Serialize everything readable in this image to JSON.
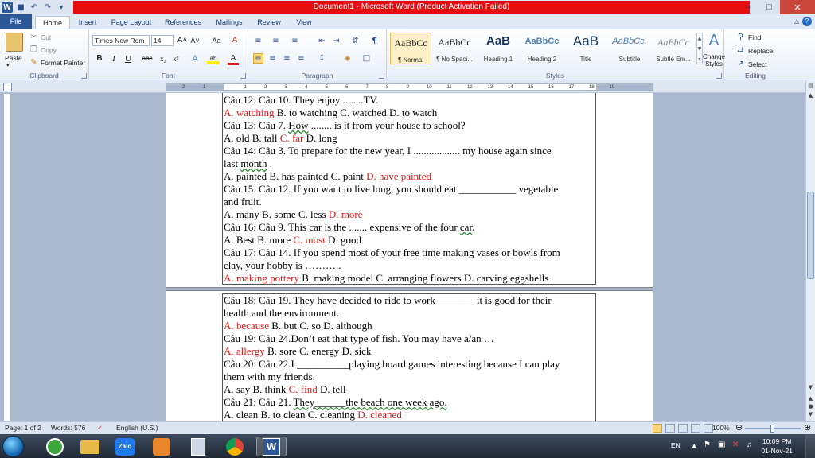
{
  "window": {
    "title": "Document1 - Microsoft Word (Product Activation Failed)",
    "controls": {
      "minimize": "–",
      "maximize": "□",
      "close": "✕"
    }
  },
  "quick_access": {
    "app_icon": "W",
    "save": "■",
    "undo": "↶",
    "redo": "↷",
    "customize": "▾"
  },
  "tabs": [
    "File",
    "Home",
    "Insert",
    "Page Layout",
    "References",
    "Mailings",
    "Review",
    "View"
  ],
  "active_tab": "Home",
  "help_icon": "?",
  "ribbon": {
    "clipboard": {
      "label": "Clipboard",
      "paste": "Paste",
      "cut": "Cut",
      "copy": "Copy",
      "format_painter": "Format Painter"
    },
    "font": {
      "label": "Font",
      "font_name": "Times New Rom",
      "font_size": "14",
      "bold": "B",
      "italic": "I",
      "underline": "U",
      "strike": "abc",
      "subscript": "x₂",
      "superscript": "x²",
      "grow": "A˄",
      "shrink": "A˅",
      "change_case": "Aa",
      "clear": "A",
      "text_effects": "A",
      "highlight": "ab",
      "font_color": "A"
    },
    "paragraph": {
      "label": "Paragraph"
    },
    "styles": {
      "label": "Styles",
      "items": [
        {
          "preview": "AaBbCc",
          "name": "¶ Normal"
        },
        {
          "preview": "AaBbCc",
          "name": "¶ No Spaci..."
        },
        {
          "preview": "AaB",
          "name": "Heading 1"
        },
        {
          "preview": "AaBbCc",
          "name": "Heading 2"
        },
        {
          "preview": "AaB",
          "name": "Title"
        },
        {
          "preview": "AaBbCc.",
          "name": "Subtitle"
        },
        {
          "preview": "AaBbCc",
          "name": "Subtle Em..."
        }
      ],
      "change_styles": "Change Styles"
    },
    "editing": {
      "label": "Editing",
      "find": "Find",
      "replace": "Replace",
      "select": "Select"
    }
  },
  "ruler_ticks": [
    "2",
    "1",
    "1",
    "2",
    "3",
    "4",
    "5",
    "6",
    "7",
    "8",
    "9",
    "10",
    "11",
    "12",
    "13",
    "14",
    "15",
    "16",
    "17",
    "18",
    "19"
  ],
  "page1_lines": [
    [
      {
        "t": "Câu 12: Câu 10. They enjoy ........TV."
      }
    ],
    [
      {
        "t": "A. watching",
        "c": "red"
      },
      {
        "t": " B. to watching C. watched D. to watch"
      }
    ],
    [
      {
        "t": "Câu 13: Câu 7. "
      },
      {
        "t": "How",
        "c": "squig"
      },
      {
        "t": " ........ is it from your house to school?"
      }
    ],
    [
      {
        "t": "A. old B. tall "
      },
      {
        "t": "C. far",
        "c": "red"
      },
      {
        "t": " D. long"
      }
    ],
    [
      {
        "t": "Câu 14: Câu 3.  To prepare for the new year, I .................. my house again since"
      }
    ],
    [
      {
        "t": "last "
      },
      {
        "t": "month",
        "c": "squig"
      },
      {
        "t": " ."
      }
    ],
    [
      {
        "t": " A. painted B. has painted C. paint "
      },
      {
        "t": "D. have painted",
        "c": "red"
      }
    ],
    [
      {
        "t": " Câu 15: Câu 12. If you want to live long, you should eat ___________ vegetable"
      }
    ],
    [
      {
        "t": "and fruit."
      }
    ],
    [
      {
        "t": "A. many B. some C. less "
      },
      {
        "t": "D. more",
        "c": "red"
      }
    ],
    [
      {
        "t": "Câu 16: Câu 9.  This car is the ....... expensive of the four "
      },
      {
        "t": "car",
        "c": "squig"
      },
      {
        "t": "."
      }
    ],
    [
      {
        "t": "A. Best B. more "
      },
      {
        "t": "C. most",
        "c": "red"
      },
      {
        "t": " D. good"
      }
    ],
    [
      {
        "t": " Câu 17: Câu 14. If you spend most of your free time making vases or bowls from"
      }
    ],
    [
      {
        "t": "clay, your hobby is ……….."
      }
    ],
    [
      {
        "t": "A. making pottery",
        "c": "red"
      },
      {
        "t": " B. making model C. arranging flowers D. carving eggshells"
      }
    ]
  ],
  "page2_lines": [
    [
      {
        "t": "Câu 18: Câu 19. They have decided to ride to work _______ it is good for their"
      }
    ],
    [
      {
        "t": "health and the environment."
      }
    ],
    [
      {
        "t": " A. because",
        "c": "red"
      },
      {
        "t": " B. but C. so D. although"
      }
    ],
    [
      {
        "t": "Câu 19: Câu 24.Don’t eat that type of fish. You may have a/an …"
      }
    ],
    [
      {
        "t": "A. allergy",
        "c": "red"
      },
      {
        "t": " B. sore C. energy D. sick"
      }
    ],
    [
      {
        "t": "Câu 20: Câu 22.I __________playing board games interesting because I can play"
      }
    ],
    [
      {
        "t": "them with my friends."
      }
    ],
    [
      {
        "t": " A. say B. think "
      },
      {
        "t": "C. find",
        "c": "red"
      },
      {
        "t": " D. tell"
      }
    ],
    [
      {
        "t": "Câu 21: Câu 21. "
      },
      {
        "t": "They______the beach one week ago.",
        "c": "squig"
      }
    ],
    [
      {
        "t": " A. clean B. to clean C. cleaning "
      },
      {
        "t": "D. cleaned",
        "c": "red"
      }
    ]
  ],
  "status": {
    "page": "Page: 1 of 2",
    "words": "Words: 576",
    "language": "English (U.S.)",
    "zoom": "100%",
    "zoom_level": 100
  },
  "taskbar": {
    "apps": [
      "Zalo"
    ],
    "lang": "EN",
    "time": "10:09 PM",
    "date": "01-Nov-21"
  },
  "colors": {
    "accent": "#2b5797",
    "activation_red": "#e60e0e",
    "answer_red": "#e11b1b"
  }
}
